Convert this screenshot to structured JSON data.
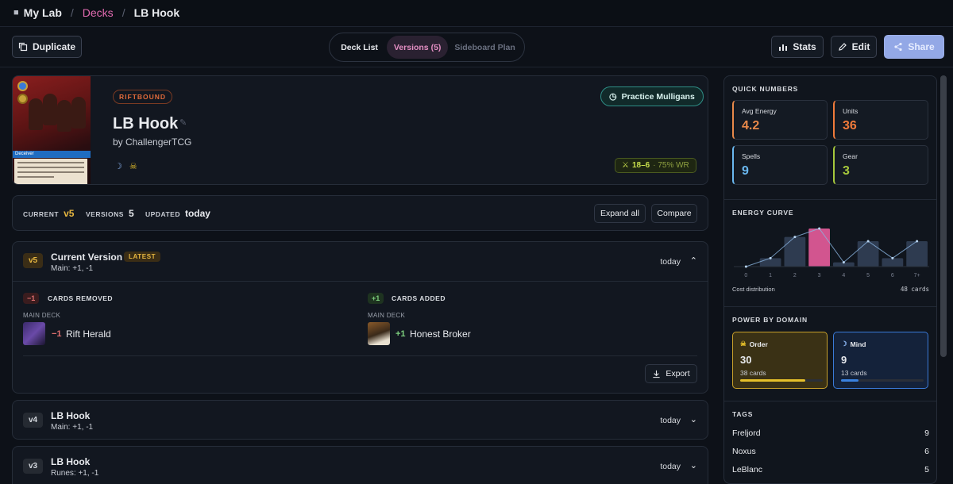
{
  "breadcrumb": {
    "lab": "My Lab",
    "sep": "/",
    "decks": "Decks",
    "deck": "LB Hook"
  },
  "toolbar": {
    "duplicate": "Duplicate",
    "tabs": [
      {
        "label": "Deck List",
        "state": "normal"
      },
      {
        "label": "Versions (5)",
        "state": "active"
      },
      {
        "label": "Sideboard Plan",
        "state": "dim"
      }
    ],
    "stats": "Stats",
    "edit": "Edit",
    "share": "Share"
  },
  "hero": {
    "game_badge": "RIFTBOUND",
    "title": "LB Hook",
    "byline": "by ChallengerTCG",
    "card_banner": "Deceiver",
    "practice": "Practice Mulligans",
    "record": "18–6",
    "winrate": "· 75% WR",
    "domain_icons": [
      "mind-icon",
      "order-icon"
    ]
  },
  "version_bar": {
    "current_label": "CURRENT",
    "current_value": "v5",
    "versions_label": "VERSIONS",
    "versions_value": "5",
    "updated_label": "UPDATED",
    "updated_value": "today",
    "expand_all": "Expand all",
    "compare": "Compare"
  },
  "versions": [
    {
      "tag": "v5",
      "title": "Current Version",
      "badge": "LATEST",
      "summary": "Main: +1, -1",
      "date": "today",
      "expanded": true,
      "removed": {
        "pill": "−1",
        "heading": "CARDS REMOVED",
        "group": "MAIN DECK",
        "delta": "−1",
        "card": "Rift Herald"
      },
      "added": {
        "pill": "+1",
        "heading": "CARDS ADDED",
        "group": "MAIN DECK",
        "delta": "+1",
        "card": "Honest Broker"
      },
      "export": "Export"
    },
    {
      "tag": "v4",
      "title": "LB Hook",
      "summary": "Main: +1, -1",
      "date": "today",
      "expanded": false
    },
    {
      "tag": "v3",
      "title": "LB Hook",
      "summary": "Runes: +1, -1",
      "date": "today",
      "expanded": false
    }
  ],
  "sidebar": {
    "quick_numbers": {
      "title": "QUICK NUMBERS",
      "items": [
        {
          "label": "Avg Energy",
          "value": "4.2",
          "color": "#e8894a"
        },
        {
          "label": "Units",
          "value": "36",
          "color": "#f07a3a"
        },
        {
          "label": "Spells",
          "value": "9",
          "color": "#6ab8f0"
        },
        {
          "label": "Gear",
          "value": "3",
          "color": "#a6c83c"
        }
      ]
    },
    "energy_curve": {
      "title": "ENERGY CURVE",
      "caption": "Cost distribution",
      "total": "48 cards"
    },
    "power_by_domain": {
      "title": "POWER BY DOMAIN",
      "domains": [
        {
          "name": "Order",
          "power": "30",
          "cards": "38 cards",
          "fill": 0.79,
          "color": "#e6c02a",
          "icon": "order-icon"
        },
        {
          "name": "Mind",
          "power": "9",
          "cards": "13 cards",
          "fill": 0.21,
          "color": "#3a82e0",
          "icon": "mind-icon"
        }
      ]
    },
    "tags": {
      "title": "TAGS",
      "items": [
        {
          "name": "Freljord",
          "count": "9"
        },
        {
          "name": "Noxus",
          "count": "6"
        },
        {
          "name": "LeBlanc",
          "count": "5"
        }
      ]
    }
  },
  "chart_data": {
    "type": "bar",
    "categories": [
      "0",
      "1",
      "2",
      "3",
      "4",
      "5",
      "6",
      "7+"
    ],
    "values": [
      0,
      2,
      7,
      9,
      1,
      6,
      2,
      6
    ],
    "highlight_index": 3,
    "xlabel": "Cost distribution",
    "line_overlay": true,
    "grid": false
  }
}
